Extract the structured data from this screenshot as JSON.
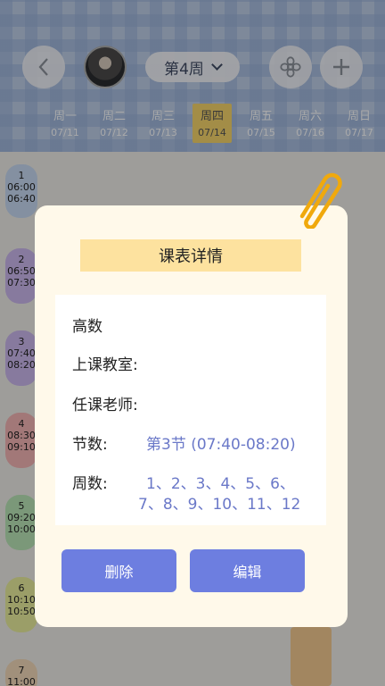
{
  "header": {
    "week_label": "第4周",
    "back_icon": "chevron-left-icon",
    "settings_icon": "flower-icon",
    "add_icon": "plus-icon"
  },
  "days": [
    {
      "name": "周一",
      "date": "07/11"
    },
    {
      "name": "周二",
      "date": "07/12"
    },
    {
      "name": "周三",
      "date": "07/13"
    },
    {
      "name": "周四",
      "date": "07/14"
    },
    {
      "name": "周五",
      "date": "07/15"
    },
    {
      "name": "周六",
      "date": "07/16"
    },
    {
      "name": "周日",
      "date": "07/17"
    }
  ],
  "slots": [
    {
      "num": "1",
      "start": "06:00",
      "end": "06:40",
      "color": "#c5d7f0"
    },
    {
      "num": "2",
      "start": "06:50",
      "end": "07:30",
      "color": "#c9b6ec"
    },
    {
      "num": "3",
      "start": "07:40",
      "end": "08:20",
      "color": "#c9b6ec"
    },
    {
      "num": "4",
      "start": "08:30",
      "end": "09:10",
      "color": "#f2b3b3"
    },
    {
      "num": "5",
      "start": "09:20",
      "end": "10:00",
      "color": "#b8e3b5"
    },
    {
      "num": "6",
      "start": "10:10",
      "end": "10:50",
      "color": "#e8ec9c"
    },
    {
      "num": "7",
      "start": "11:00",
      "end": "",
      "color": "#f0d7b8"
    }
  ],
  "dialog": {
    "title": "课表详情",
    "course": "高数",
    "classroom_label": "上课教室:",
    "teacher_label": "任课老师:",
    "period_label": "节数:",
    "period_value": "第3节 (07:40-08:20)",
    "weeks_label": "周数:",
    "weeks_line1": "1、2、3、4、5、6、",
    "weeks_line2": "7、8、9、10、11、12",
    "delete_label": "删除",
    "edit_label": "编辑"
  },
  "colors": {
    "accent": "#6d7ee0",
    "highlight": "#f3d36b",
    "title_bg": "#fde29f"
  }
}
